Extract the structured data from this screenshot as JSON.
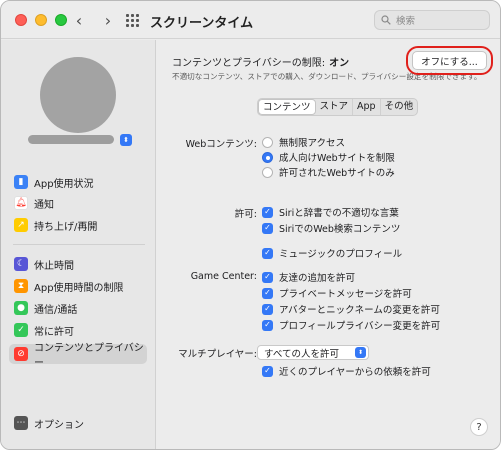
{
  "window": {
    "title": "スクリーンタイム",
    "search_placeholder": "検索"
  },
  "sidebar": {
    "groups": [
      [
        {
          "label": "App使用状況",
          "icon": "bar-chart-icon",
          "color": "#3b82f6"
        },
        {
          "label": "通知",
          "icon": "bell-icon",
          "color": "#ff3b30"
        },
        {
          "label": "持ち上げ/再開",
          "icon": "pickup-icon",
          "color": "#ffcc00"
        }
      ],
      [
        {
          "label": "休止時間",
          "icon": "moon-icon",
          "color": "#5856d6"
        },
        {
          "label": "App使用時間の制限",
          "icon": "hourglass-icon",
          "color": "#ff9500"
        },
        {
          "label": "通信/通話",
          "icon": "contacts-icon",
          "color": "#34c759"
        },
        {
          "label": "常に許可",
          "icon": "check-shield-icon",
          "color": "#34c759"
        },
        {
          "label": "コンテンツとプライバシー",
          "icon": "no-entry-icon",
          "color": "#ff3b30"
        }
      ]
    ],
    "selected": "コンテンツとプライバシー",
    "options_label": "オプション"
  },
  "content": {
    "restrict_label": "コンテンツとプライバシーの制限:",
    "restrict_state": "オン",
    "restrict_desc": "不適切なコンテンツ、ストアでの購入、ダウンロード、プライバシー設定を制限できます。",
    "off_button": "オフにする...",
    "tabs": [
      "コンテンツ",
      "ストア",
      "App",
      "その他"
    ],
    "active_tab": "コンテンツ",
    "web_label": "Webコンテンツ:",
    "web_options": [
      "無制限アクセス",
      "成人向けWebサイトを制限",
      "許可されたWebサイトのみ"
    ],
    "web_selected": 1,
    "allow_label": "許可:",
    "allow_items": [
      "Siriと辞書での不適切な言葉",
      "SiriでのWeb検索コンテンツ"
    ],
    "music_item": "ミュージックのプロフィール",
    "gc_label": "Game Center:",
    "gc_items": [
      "友達の追加を許可",
      "プライベートメッセージを許可",
      "アバターとニックネームの変更を許可",
      "プロフィールプライバシー変更を許可"
    ],
    "multi_label": "マルチプレイヤー:",
    "multi_value": "すべての人を許可",
    "nearby_item": "近くのプレイヤーからの依頼を許可",
    "help": "?"
  },
  "colors": {
    "accent": "#3478f6",
    "highlight_ring": "#e0201b"
  }
}
